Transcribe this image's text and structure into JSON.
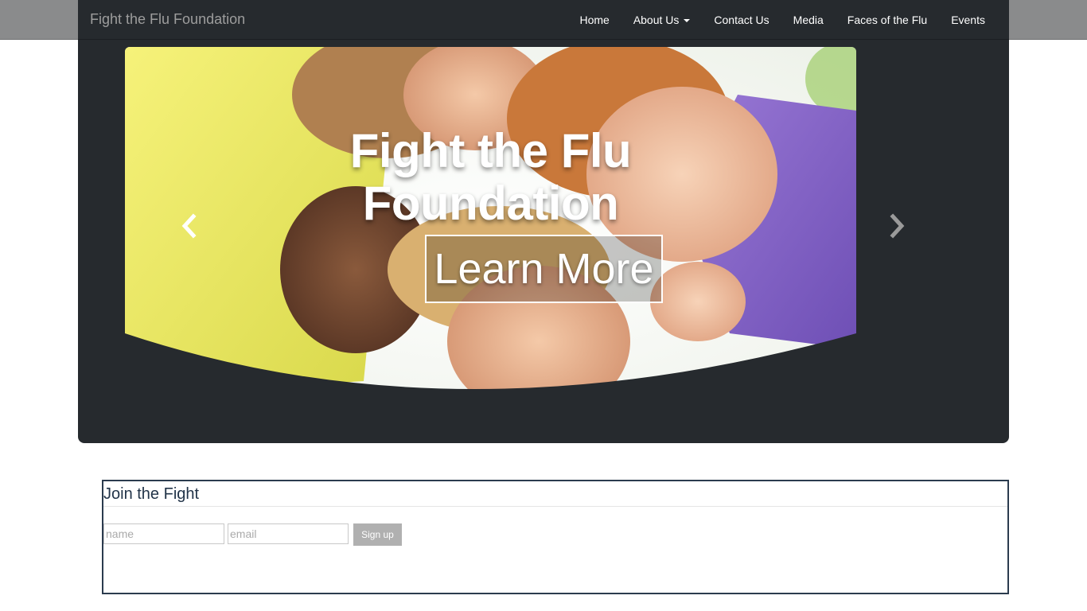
{
  "navbar": {
    "brand": "Fight the Flu Foundation",
    "items": [
      {
        "label": "Home"
      },
      {
        "label": "About Us",
        "dropdown": true
      },
      {
        "label": "Contact Us"
      },
      {
        "label": "Media"
      },
      {
        "label": "Faces of the Flu"
      },
      {
        "label": "Events"
      }
    ]
  },
  "hero": {
    "title_line1": "Fight the Flu",
    "title_line2": "Foundation",
    "cta_label": "Learn More",
    "prev_icon": "chevron-left-icon",
    "next_icon": "chevron-right-icon"
  },
  "signup": {
    "title": "Join the Fight",
    "name_placeholder": "name",
    "email_placeholder": "email",
    "button_label": "Sign up"
  },
  "colors": {
    "panel": "#262a2e",
    "topstrip": "#8a8b8c",
    "signup_border": "#2b3b4e",
    "button": "#b0b0b0"
  }
}
